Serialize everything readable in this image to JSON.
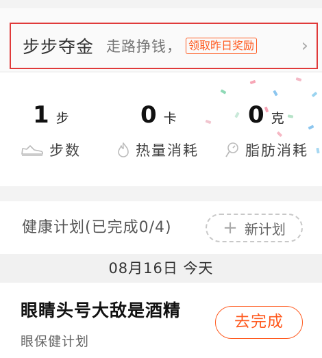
{
  "banner": {
    "title": "步步夺金",
    "subtitle": "走路挣钱，",
    "reward_button": "领取昨日奖励",
    "chevron": "›"
  },
  "stats": [
    {
      "value": "1",
      "unit": "步",
      "label": "步数",
      "icon": "shoe-icon"
    },
    {
      "value": "0",
      "unit": "卡",
      "label": "热量消耗",
      "icon": "flame-icon"
    },
    {
      "value": "0",
      "unit": "克",
      "label": "脂肪消耗",
      "icon": "scale-icon"
    }
  ],
  "health_plan": {
    "header": "健康计划(已完成0/4)",
    "new_plan_label": "新计划",
    "new_plan_icon": "plus-icon",
    "date": "08月16日 今天",
    "task": {
      "title": "眼睛头号大敌是酒精",
      "subtitle": "眼保健计划",
      "action": "去完成"
    }
  },
  "colors": {
    "accent": "#ff5a1f",
    "highlight_border": "#e03a3a",
    "background": "#f3f3f3"
  }
}
